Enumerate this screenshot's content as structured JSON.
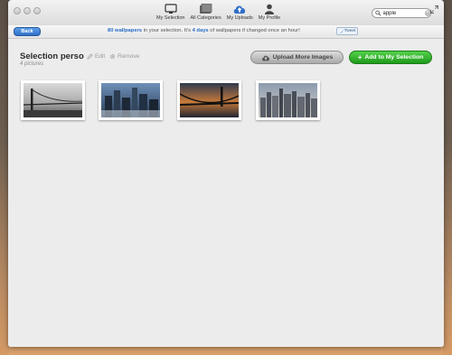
{
  "window": {
    "nav": [
      {
        "label": "My Selection",
        "icon": "monitor-icon"
      },
      {
        "label": "All Categories",
        "icon": "folders-icon"
      },
      {
        "label": "My Uploads",
        "icon": "cloud-upload-icon"
      },
      {
        "label": "My Profile",
        "icon": "person-icon"
      }
    ],
    "search": {
      "value": "apple",
      "placeholder": ""
    }
  },
  "infobar": {
    "back_label": "Back",
    "count": "80 wallpapers",
    "text_mid": " in your selection. It's ",
    "days": "4 days",
    "text_end": " of wallpapers if changed once an hour!",
    "tweet_label": "Tweet"
  },
  "selection": {
    "title": "Selection perso",
    "subtitle": "4 pictures",
    "edit_label": "Edit",
    "remove_label": "Remove",
    "upload_label": "Upload More Images",
    "add_label": "Add to My Selection",
    "add_plus": "+",
    "thumbnails": [
      {
        "subject": "golden-gate-bridge-bw"
      },
      {
        "subject": "city-skyline-blue"
      },
      {
        "subject": "bridge-sunset"
      },
      {
        "subject": "manhattan-skyline"
      }
    ]
  },
  "colors": {
    "accent_blue": "#2f6fc8",
    "add_green": "#1f9a1b",
    "highlight_text": "#2b6fc5"
  }
}
